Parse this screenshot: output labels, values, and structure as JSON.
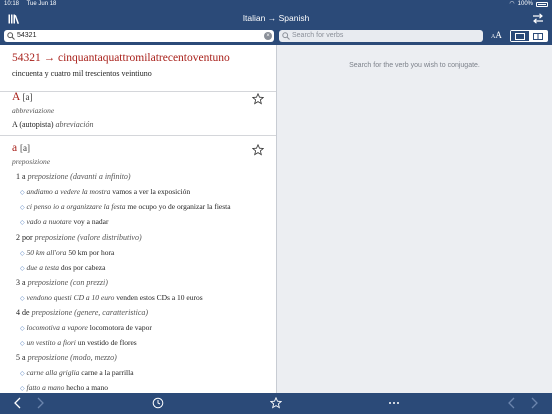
{
  "status": {
    "time": "10:18",
    "date": "Tue Jun 18",
    "battery": "100%"
  },
  "nav": {
    "title": "Italian → Spanish"
  },
  "search": {
    "query": "54321",
    "verb_placeholder": "Search for verbs"
  },
  "conjugate_hint": "Search for the verb you wish to conjugate.",
  "number_entry": {
    "headword": "54321 → cinquantaquattromilatrecentoventuno",
    "translation": "cincuenta y cuatro mil trescientos veintiuno"
  },
  "entry_A": {
    "headword": "A",
    "pron": "[a]",
    "pos": "abbreviazione",
    "line_plain": "A (autopista)",
    "line_it": "abreviación"
  },
  "entry_a": {
    "headword": "a",
    "pron": "[a]",
    "pos": "preposizione",
    "senses": [
      {
        "num": "1 a",
        "cat": "preposizione",
        "note": "(davanti a infinito)"
      },
      {
        "num": "2 por",
        "cat": "preposizione",
        "note": "(valore distributivo)"
      },
      {
        "num": "3 a",
        "cat": "preposizione",
        "note": "(con prezzi)"
      },
      {
        "num": "4 de",
        "cat": "preposizione",
        "note": "(genere, caratteristica)"
      },
      {
        "num": "5 a",
        "cat": "preposizione",
        "note": "(modo, mezzo)"
      }
    ],
    "examples": [
      {
        "it": "andiamo a vedere la mostra",
        "es": "vamos a ver la exposición"
      },
      {
        "it": "ci penso io a organizzare la festa",
        "es": "me ocupo yo de organizar la fiesta"
      },
      {
        "it": "vado a nuotare",
        "es": "voy a nadar"
      },
      {
        "it": "50 km all'ora",
        "es": "50 km por hora"
      },
      {
        "it": "due a testa",
        "es": "dos por cabeza"
      },
      {
        "it": "vendono questi CD a 10 euro",
        "es": "venden estos CDs a 10 euros"
      },
      {
        "it": "locomotiva a vapore",
        "es": "locomotora de vapor"
      },
      {
        "it": "un vestito a fiori",
        "es": "un vestido de flores"
      },
      {
        "it": "carne alla griglia",
        "es": "carne a la parrilla"
      },
      {
        "it": "fatto a mano",
        "es": "hecho a mano"
      }
    ]
  },
  "font_button": {
    "small": "A",
    "large": "A"
  },
  "colors": {
    "chrome": "#2b4a78",
    "headword": "#a8201a",
    "bullet": "#5b86c4"
  }
}
